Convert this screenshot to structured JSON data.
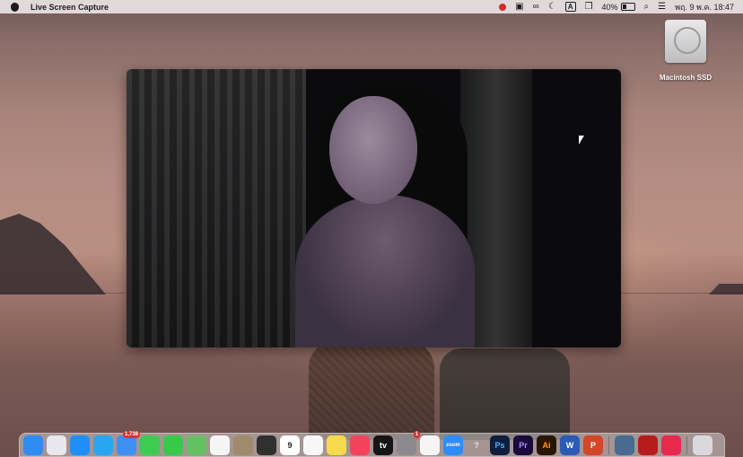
{
  "menubar": {
    "app_name": "Live Screen Capture",
    "battery_percent": "40%",
    "battery_level": 0.4,
    "clock": "พฤ. 9 พ.ค.  18:47",
    "keyboard_indicator": "A",
    "icons": [
      "recording-indicator-icon",
      "screen-mirroring-icon",
      "creative-cloud-icon",
      "do-not-disturb-icon",
      "keyboard-input-icon",
      "screens-icon",
      "battery-icon",
      "search-icon",
      "control-center-icon"
    ]
  },
  "desktop": {
    "disk_label": "Macintosh SSD"
  },
  "dock": {
    "items": [
      {
        "name": "finder",
        "color": "#2f8cf0"
      },
      {
        "name": "launchpad",
        "color": "#e8e8ec"
      },
      {
        "name": "app-store",
        "color": "#1f8ef5"
      },
      {
        "name": "safari",
        "color": "#2aa6f0"
      },
      {
        "name": "mail",
        "color": "#3f8ff5",
        "badge": "1,738"
      },
      {
        "name": "facetime",
        "color": "#3fcb4f"
      },
      {
        "name": "messages",
        "color": "#39c94a"
      },
      {
        "name": "maps",
        "color": "#63c162"
      },
      {
        "name": "photos",
        "color": "#f5f5f5"
      },
      {
        "name": "archive",
        "color": "#a08a6c"
      },
      {
        "name": "calculator",
        "color": "#303030"
      },
      {
        "name": "calendar",
        "color": "#ffffff",
        "text": "9",
        "text_color": "#222222"
      },
      {
        "name": "reminders",
        "color": "#f7f7f7"
      },
      {
        "name": "notes",
        "color": "#f6d94d"
      },
      {
        "name": "music",
        "color": "#f2435a"
      },
      {
        "name": "tv",
        "color": "#151515",
        "text": "tv"
      },
      {
        "name": "system-settings",
        "color": "#8a8a8e",
        "badge": "1"
      },
      {
        "name": "chrome",
        "color": "#f5f5f5"
      },
      {
        "name": "zoom",
        "color": "#2d8cff",
        "text": "zoom"
      },
      {
        "name": "help",
        "color": "transparent",
        "text": "?",
        "text_color": "#e9e9e9"
      },
      {
        "name": "photoshop",
        "color": "#0d1f3c",
        "text": "Ps",
        "text_color": "#4fb0ff"
      },
      {
        "name": "premiere",
        "color": "#1a0a3a",
        "text": "Pr",
        "text_color": "#b08cff"
      },
      {
        "name": "illustrator",
        "color": "#2a1500",
        "text": "Ai",
        "text_color": "#ff9a00"
      },
      {
        "name": "word",
        "color": "#2b5bb5",
        "text": "W"
      },
      {
        "name": "powerpoint",
        "color": "#d24726",
        "text": "P"
      },
      {
        "name": "separator"
      },
      {
        "name": "screen-recording",
        "color": "#4a6a90"
      },
      {
        "name": "photo-booth",
        "color": "#b71c1c"
      },
      {
        "name": "creative-cloud",
        "color": "#e8294d"
      },
      {
        "name": "separator"
      },
      {
        "name": "trash",
        "color": "#d9d9dd"
      }
    ]
  }
}
